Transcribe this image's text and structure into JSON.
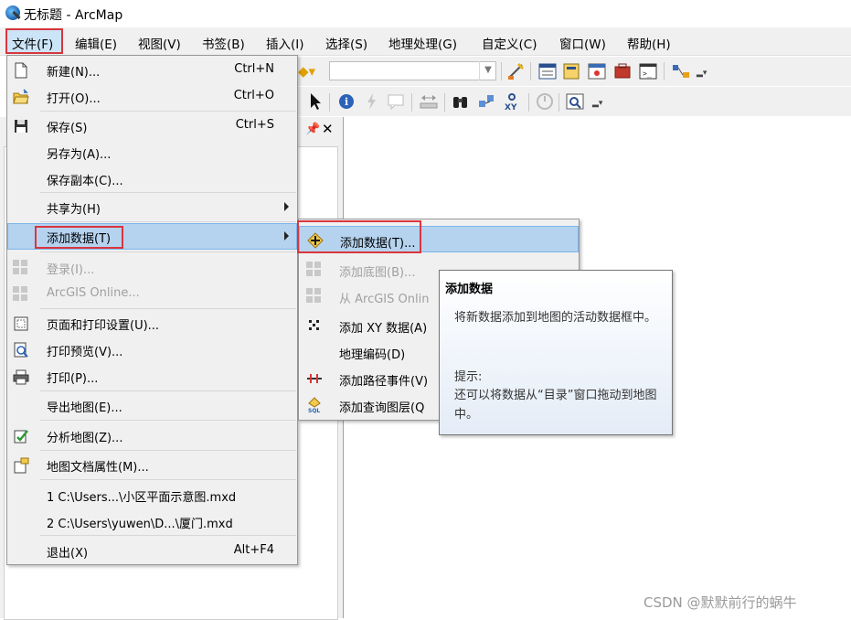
{
  "window": {
    "title": "无标题 - ArcMap"
  },
  "menubar": {
    "items": [
      "文件(F)",
      "编辑(E)",
      "视图(V)",
      "书签(B)",
      "插入(I)",
      "选择(S)",
      "地理处理(G)",
      "自定义(C)",
      "窗口(W)",
      "帮助(H)"
    ]
  },
  "file_menu": {
    "items": [
      {
        "label": "新建(N)...",
        "shortcut": "Ctrl+N",
        "icon": "new-document-icon"
      },
      {
        "label": "打开(O)...",
        "shortcut": "Ctrl+O",
        "icon": "open-folder-icon"
      },
      {
        "label": "保存(S)",
        "shortcut": "Ctrl+S",
        "icon": "save-disk-icon"
      },
      {
        "label": "另存为(A)...",
        "shortcut": ""
      },
      {
        "label": "保存副本(C)...",
        "shortcut": ""
      },
      {
        "label": "共享为(H)",
        "shortcut": "",
        "submenu": true
      },
      {
        "label": "添加数据(T)",
        "shortcut": "",
        "submenu": true,
        "highlighted": true
      },
      {
        "label": "登录(I)...",
        "shortcut": "",
        "disabled": true,
        "icon": "grid-icon"
      },
      {
        "label": "ArcGIS Online...",
        "shortcut": "",
        "disabled": true,
        "icon": "grid-icon"
      },
      {
        "label": "页面和打印设置(U)...",
        "shortcut": "",
        "icon": "page-setup-icon"
      },
      {
        "label": "打印预览(V)...",
        "shortcut": "",
        "icon": "print-preview-icon"
      },
      {
        "label": "打印(P)...",
        "shortcut": "",
        "icon": "printer-icon"
      },
      {
        "label": "导出地图(E)...",
        "shortcut": ""
      },
      {
        "label": "分析地图(Z)...",
        "shortcut": "",
        "icon": "analyze-map-icon"
      },
      {
        "label": "地图文档属性(M)...",
        "shortcut": "",
        "icon": "document-properties-icon"
      },
      {
        "label": "1 C:\\Users...\\小区平面示意图.mxd",
        "shortcut": ""
      },
      {
        "label": "2 C:\\Users\\yuwen\\D...\\厦门.mxd",
        "shortcut": ""
      },
      {
        "label": "退出(X)",
        "shortcut": "Alt+F4"
      }
    ]
  },
  "add_data_submenu": {
    "items": [
      {
        "label": "添加数据(T)...",
        "icon": "add-data-plus-icon",
        "highlighted": true
      },
      {
        "label": "添加底图(B)...",
        "icon": "grid-icon",
        "disabled": true
      },
      {
        "label": "从 ArcGIS Onlin",
        "icon": "grid-icon",
        "disabled": true
      },
      {
        "label": "添加 XY 数据(A)",
        "icon": "xy-data-icon"
      },
      {
        "label": "地理编码(D)",
        "icon": ""
      },
      {
        "label": "添加路径事件(V)",
        "icon": "route-events-icon"
      },
      {
        "label": "添加查询图层(Q",
        "icon": "sql-query-icon"
      }
    ]
  },
  "tooltip": {
    "title": "添加数据",
    "body": "将新数据添加到地图的活动数据框中。",
    "hint_label": "提示:",
    "hint_body": "还可以将数据从“目录”窗口拖动到地图中。"
  },
  "watermark": "CSDN @默默前行的蜗牛",
  "colors": {
    "highlight": "#b5d3ef",
    "annotation_red": "#d9363e",
    "menu_bg": "#f0f0f0"
  }
}
